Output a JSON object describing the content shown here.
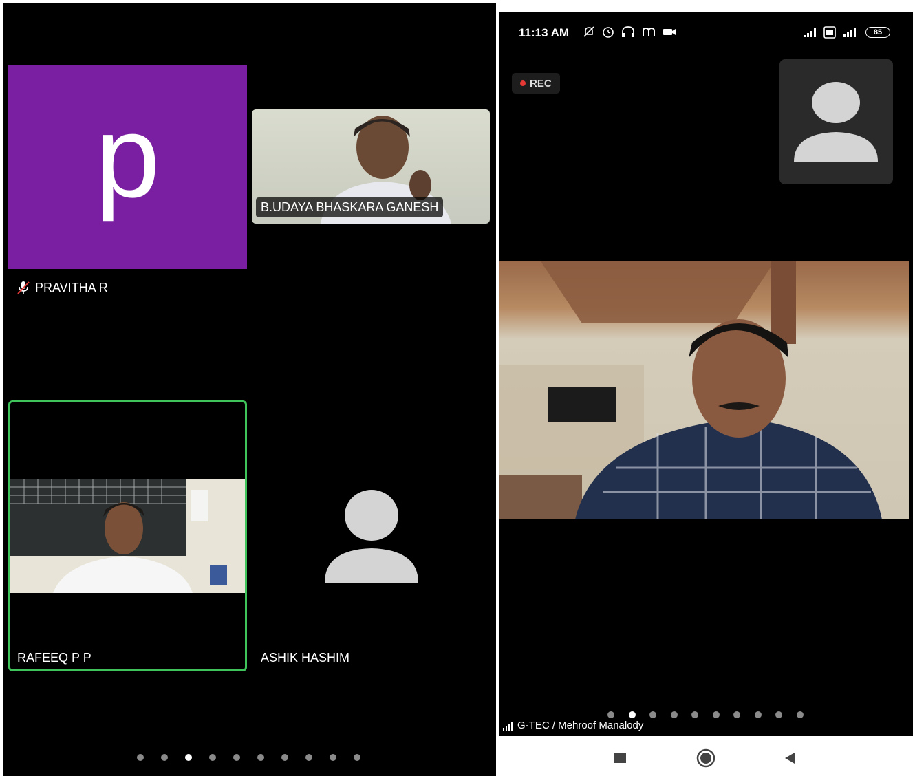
{
  "left": {
    "participants": {
      "pravitha": {
        "initial": "p",
        "name": "PRAVITHA R",
        "avatar_color": "#7b1fa2",
        "muted_icon": "mic-off-icon"
      },
      "udaya": {
        "name": "B.UDAYA BHASKARA GANESH"
      },
      "rafeeq": {
        "name": "RAFEEQ P P",
        "active_speaker_color": "#3ec45b"
      },
      "ashik": {
        "name": "ASHIK HASHIM",
        "avatar_icon": "person-icon"
      }
    },
    "page_dots": {
      "count": 10,
      "active_index": 2
    }
  },
  "right": {
    "status_bar": {
      "time": "11:13 AM",
      "battery": "85"
    },
    "rec_label": "REC",
    "meeting_label": "G-TEC / Mehroof Manalody",
    "page_dots": {
      "count": 10,
      "active_index": 1
    }
  },
  "navbar": {
    "icons": [
      "recent-apps-icon",
      "home-icon",
      "back-icon"
    ]
  }
}
